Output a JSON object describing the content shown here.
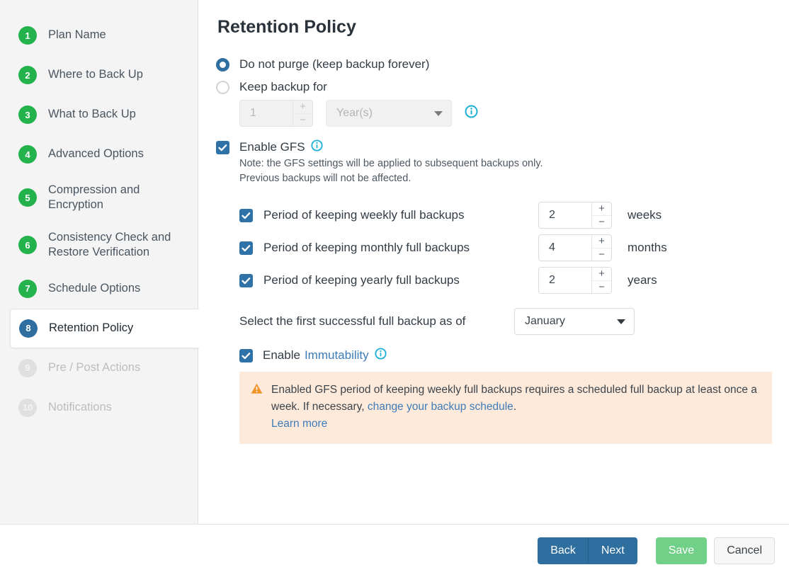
{
  "sidebar": {
    "items": [
      {
        "num": "1",
        "label": "Plan Name",
        "state": "done"
      },
      {
        "num": "2",
        "label": "Where to Back Up",
        "state": "done"
      },
      {
        "num": "3",
        "label": "What to Back Up",
        "state": "done"
      },
      {
        "num": "4",
        "label": "Advanced Options",
        "state": "done"
      },
      {
        "num": "5",
        "label": "Compression and Encryption",
        "state": "done"
      },
      {
        "num": "6",
        "label": "Consistency Check and Restore Verification",
        "state": "done"
      },
      {
        "num": "7",
        "label": "Schedule Options",
        "state": "done"
      },
      {
        "num": "8",
        "label": "Retention Policy",
        "state": "active"
      },
      {
        "num": "9",
        "label": "Pre / Post Actions",
        "state": "disabled"
      },
      {
        "num": "10",
        "label": "Notifications",
        "state": "disabled"
      }
    ]
  },
  "main": {
    "title": "Retention Policy",
    "purge_forever": {
      "label": "Do not purge (keep backup forever)",
      "checked": true
    },
    "keep_for": {
      "label": "Keep backup for",
      "checked": false,
      "amount": "1",
      "unit_placeholder": "Year(s)",
      "info_icon": "info-icon"
    },
    "gfs": {
      "label": "Enable GFS",
      "checked": true,
      "info_icon": "info-icon",
      "note_line_1": "Note: the GFS settings will be applied to subsequent backups only.",
      "note_line_2": "Previous backups will not be affected.",
      "periods": [
        {
          "label": "Period of keeping weekly full backups",
          "value": "2",
          "unit": "weeks",
          "checked": true
        },
        {
          "label": "Period of keeping monthly full backups",
          "value": "4",
          "unit": "months",
          "checked": true
        },
        {
          "label": "Period of keeping yearly full backups",
          "value": "2",
          "unit": "years",
          "checked": true
        }
      ],
      "as_of": {
        "label": "Select the first successful full backup as of",
        "value": "January"
      }
    },
    "immutability": {
      "prefix": "Enable",
      "link": "Immutability",
      "checked": true,
      "info_icon": "info-icon"
    },
    "warning": {
      "icon": "warning-triangle-icon",
      "text_part_1": "Enabled GFS period of keeping weekly full backups requires a scheduled full backup at least once a week. If necessary,",
      "link_1": "change your backup schedule",
      "text_part_2": ".",
      "link_2": "Learn more"
    }
  },
  "footer": {
    "back": "Back",
    "next": "Next",
    "save": "Save",
    "cancel": "Cancel"
  },
  "colors": {
    "accent_blue": "#2f6fa0",
    "step_green": "#23b24b",
    "save_green": "#70d088",
    "info_cyan": "#1bb0d6",
    "warn_bg": "#fdeadb",
    "warn_orange": "#f0932b",
    "link_blue": "#3d7cb8"
  }
}
